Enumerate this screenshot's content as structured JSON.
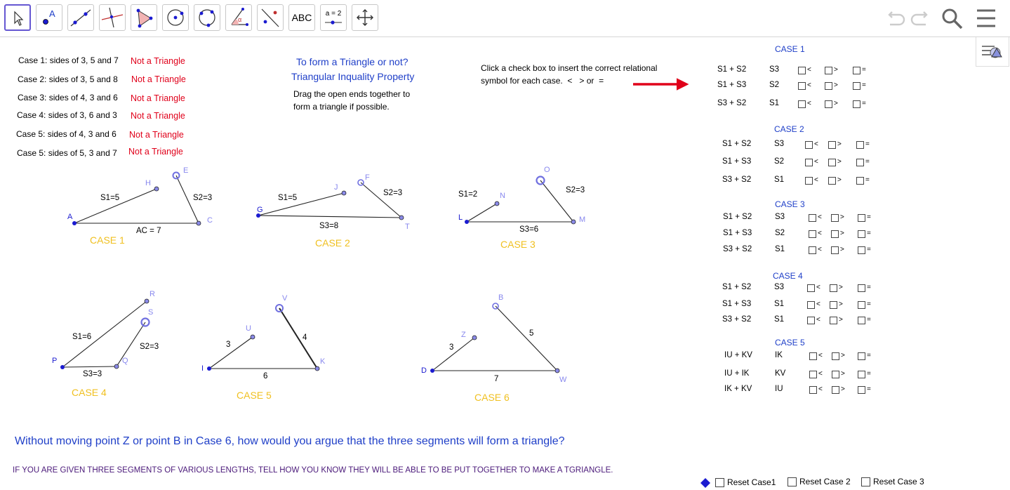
{
  "toolbar": {
    "tools": [
      {
        "name": "move-tool-icon"
      },
      {
        "name": "point-tool-icon",
        "label": "A"
      },
      {
        "name": "line-tool-icon"
      },
      {
        "name": "perpendicular-line-tool-icon"
      },
      {
        "name": "polygon-tool-icon"
      },
      {
        "name": "circle-center-point-tool-icon"
      },
      {
        "name": "circle-three-points-tool-icon"
      },
      {
        "name": "angle-tool-icon",
        "label": "α"
      },
      {
        "name": "reflect-tool-icon"
      },
      {
        "name": "text-tool-icon",
        "label": "ABC"
      },
      {
        "name": "slider-tool-icon",
        "label": "a = 2"
      },
      {
        "name": "move-graphics-view-tool-icon"
      }
    ],
    "right_icons": [
      "undo-icon",
      "redo-icon",
      "search-icon",
      "menu-icon"
    ]
  },
  "cases": [
    {
      "text": "Case 1: sides of 3, 5 and 7",
      "result": "Not a Triangle"
    },
    {
      "text": "Case 2: sides of 3, 5 and 8",
      "result": "Not a Triangle"
    },
    {
      "text": "Case 3: sides of 4, 3 and 6",
      "result": "Not a Triangle"
    },
    {
      "text": "Case 4: sides of 3, 6 and 3",
      "result": "Not a Triangle"
    },
    {
      "text": "Case 5: sides of 4, 3 and 6",
      "result": "Not a Triangle"
    },
    {
      "text": "Case 5: sides of 5, 3 and 7",
      "result": "Not a Triangle"
    }
  ],
  "title": {
    "line1": "To form a Triangle or not?",
    "line2": "Triangular Inquality Property"
  },
  "drag_instructions": {
    "line1": "Drag the open ends together to",
    "line2": "form a triangle if possible."
  },
  "click_instructions": {
    "line1": "Click a check box to insert the correct relational",
    "line2": "symbol for each case.  <   > or  ="
  },
  "figures": {
    "case1": {
      "label": "CASE 1",
      "points": {
        "A": "A",
        "H": "H",
        "E": "E",
        "C": "C"
      },
      "s1": "S1=5",
      "s2": "S2=3",
      "base": "AC = 7"
    },
    "case2": {
      "label": "CASE 2",
      "points": {
        "G": "G",
        "J": "J",
        "F": "F",
        "T": "T"
      },
      "s1": "S1=5",
      "s2": "S2=3",
      "base": "S3=8"
    },
    "case3": {
      "label": "CASE 3",
      "points": {
        "L": "L",
        "N": "N",
        "O": "O",
        "M": "M"
      },
      "s1": "S1=2",
      "s2": "S2=3",
      "base": "S3=6"
    },
    "case4": {
      "label": "CASE 4",
      "points": {
        "P": "P",
        "R": "R",
        "S": "S",
        "Q": "Q"
      },
      "s1": "S1=6",
      "s2": "S2=3",
      "base": "S3=3"
    },
    "case5": {
      "label": "CASE 5",
      "points": {
        "I": "I",
        "U": "U",
        "V": "V",
        "K": "K"
      },
      "s1": "3",
      "s2": "4",
      "base": "6"
    },
    "case6": {
      "label": "CASE 6",
      "points": {
        "D": "D",
        "Z": "Z",
        "B": "B",
        "W": "W"
      },
      "s1": "3",
      "s2": "5",
      "base": "7"
    }
  },
  "relations": {
    "symbols": {
      "lt": "<",
      "gt": ">",
      "eq": "="
    },
    "case1": {
      "header": "CASE 1",
      "rows": [
        {
          "sum": "S1 + S2",
          "side": "S3"
        },
        {
          "sum": "S1 + S3",
          "side": "S2"
        },
        {
          "sum": "S3 + S2",
          "side": "S1"
        }
      ]
    },
    "case2": {
      "header": "CASE 2",
      "rows": [
        {
          "sum": "S1 + S2",
          "side": "S3"
        },
        {
          "sum": "S1 + S3",
          "side": "S2"
        },
        {
          "sum": "S3 + S2",
          "side": "S1"
        }
      ]
    },
    "case3": {
      "header": "CASE 3",
      "rows": [
        {
          "sum": "S1 + S2",
          "side": "S3"
        },
        {
          "sum": "S1 + S3",
          "side": "S2"
        },
        {
          "sum": "S3 + S2",
          "side": "S1"
        }
      ]
    },
    "case4": {
      "header": "CASE 4",
      "rows": [
        {
          "sum": "S1 + S2",
          "side": "S3"
        },
        {
          "sum": "S1 + S3",
          "side": "S1"
        },
        {
          "sum": "S3 + S2",
          "side": "S1"
        }
      ]
    },
    "case5": {
      "header": "CASE 5",
      "rows": [
        {
          "sum": "IU + KV",
          "side": "IK"
        },
        {
          "sum": "IU + IK",
          "side": "KV"
        },
        {
          "sum": "IK + KV",
          "side": "IU"
        }
      ]
    }
  },
  "question": "Without moving point Z or point B in Case 6, how would you argue that the three segments will form a triangle?",
  "prompt": "IF YOU ARE GIVEN THREE SEGMENTS OF VARIOUS LENGTHS, TELL HOW YOU KNOW THEY WILL BE ABLE TO BE PUT TOGETHER TO MAKE A TGRIANGLE.",
  "reset": {
    "case1": "Reset Case1",
    "case2": "Reset Case 2",
    "case3": "Reset Case 3"
  },
  "colors": {
    "accent": "#6557d2",
    "blue_text": "#1f3fc8",
    "red_text": "#e0001a",
    "case_label": "#f0c020",
    "point_label": "#8888ee",
    "arrow": "#e0001a"
  }
}
